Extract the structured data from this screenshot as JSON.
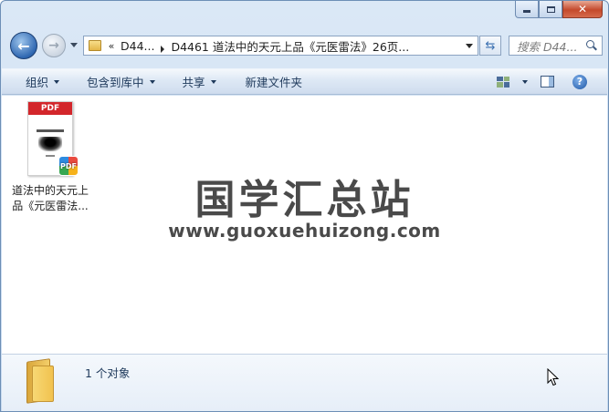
{
  "window": {
    "close_glyph": "✕"
  },
  "navigation": {
    "back_glyph": "←",
    "forward_glyph": "→",
    "breadcrumb_overflow": "«",
    "breadcrumb": [
      "D44...",
      "D4461 道法中的天元上品《元医雷法》26页..."
    ],
    "refresh_glyph": "⇆",
    "search_placeholder": "搜索 D44..."
  },
  "toolbar": {
    "organize": "组织",
    "include_in_library": "包含到库中",
    "share": "共享",
    "new_folder": "新建文件夹",
    "help_glyph": "?"
  },
  "files": [
    {
      "name": "道法中的天元上品《元医雷法...",
      "type_label": "PDF",
      "badge_label": "PDF"
    }
  ],
  "watermark": {
    "title": "国学汇总站",
    "url": "www.guoxuehuizong.com"
  },
  "details": {
    "object_count": "1 个对象"
  },
  "icons": {
    "back": "back-arrow-icon",
    "forward": "forward-arrow-icon",
    "folder": "folder-icon",
    "refresh": "refresh-icon",
    "search": "search-icon",
    "views": "change-view-icon",
    "preview_pane": "preview-pane-icon",
    "help": "help-icon",
    "pdf": "pdf-file-icon",
    "cursor": "mouse-pointer-icon"
  },
  "colors": {
    "window_frame": "#c6d9ef",
    "toolbar_text": "#1e395b",
    "pdf_red": "#d3262b",
    "close_button": "#c4492c"
  }
}
